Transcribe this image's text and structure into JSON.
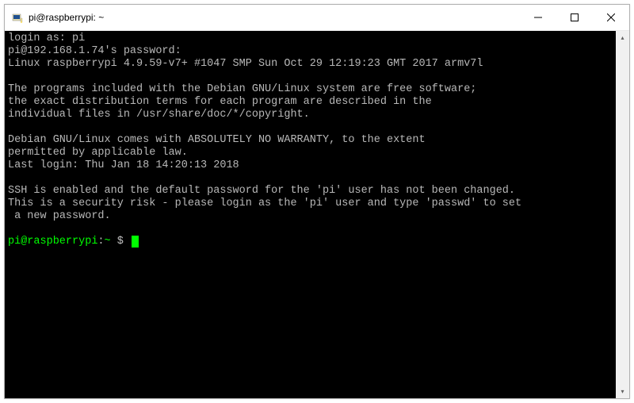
{
  "window": {
    "title": "pi@raspberrypi: ~",
    "icon_name": "putty-icon"
  },
  "terminal": {
    "lines": {
      "login_as": "login as: pi",
      "password_prompt": "pi@192.168.1.74's password:",
      "kernel": "Linux raspberrypi 4.9.59-v7+ #1047 SMP Sun Oct 29 12:19:23 GMT 2017 armv7l",
      "blank1": "",
      "motd1": "The programs included with the Debian GNU/Linux system are free software;",
      "motd2": "the exact distribution terms for each program are described in the",
      "motd3": "individual files in /usr/share/doc/*/copyright.",
      "blank2": "",
      "warranty1": "Debian GNU/Linux comes with ABSOLUTELY NO WARRANTY, to the extent",
      "warranty2": "permitted by applicable law.",
      "last_login": "Last login: Thu Jan 18 14:20:13 2018",
      "blank3": "",
      "ssh1": "SSH is enabled and the default password for the 'pi' user has not been changed.",
      "ssh2": "This is a security risk - please login as the 'pi' user and type 'passwd' to set",
      "ssh3": " a new password.",
      "blank4": ""
    },
    "prompt": {
      "user_host": "pi@raspberrypi",
      "colon": ":",
      "path": "~",
      "symbol": " $"
    }
  },
  "scrollbar": {
    "up_arrow": "▴",
    "down_arrow": "▾"
  },
  "colors": {
    "terminal_bg": "#000000",
    "terminal_fg": "#c0c0c0",
    "prompt_green": "#00ff00"
  }
}
